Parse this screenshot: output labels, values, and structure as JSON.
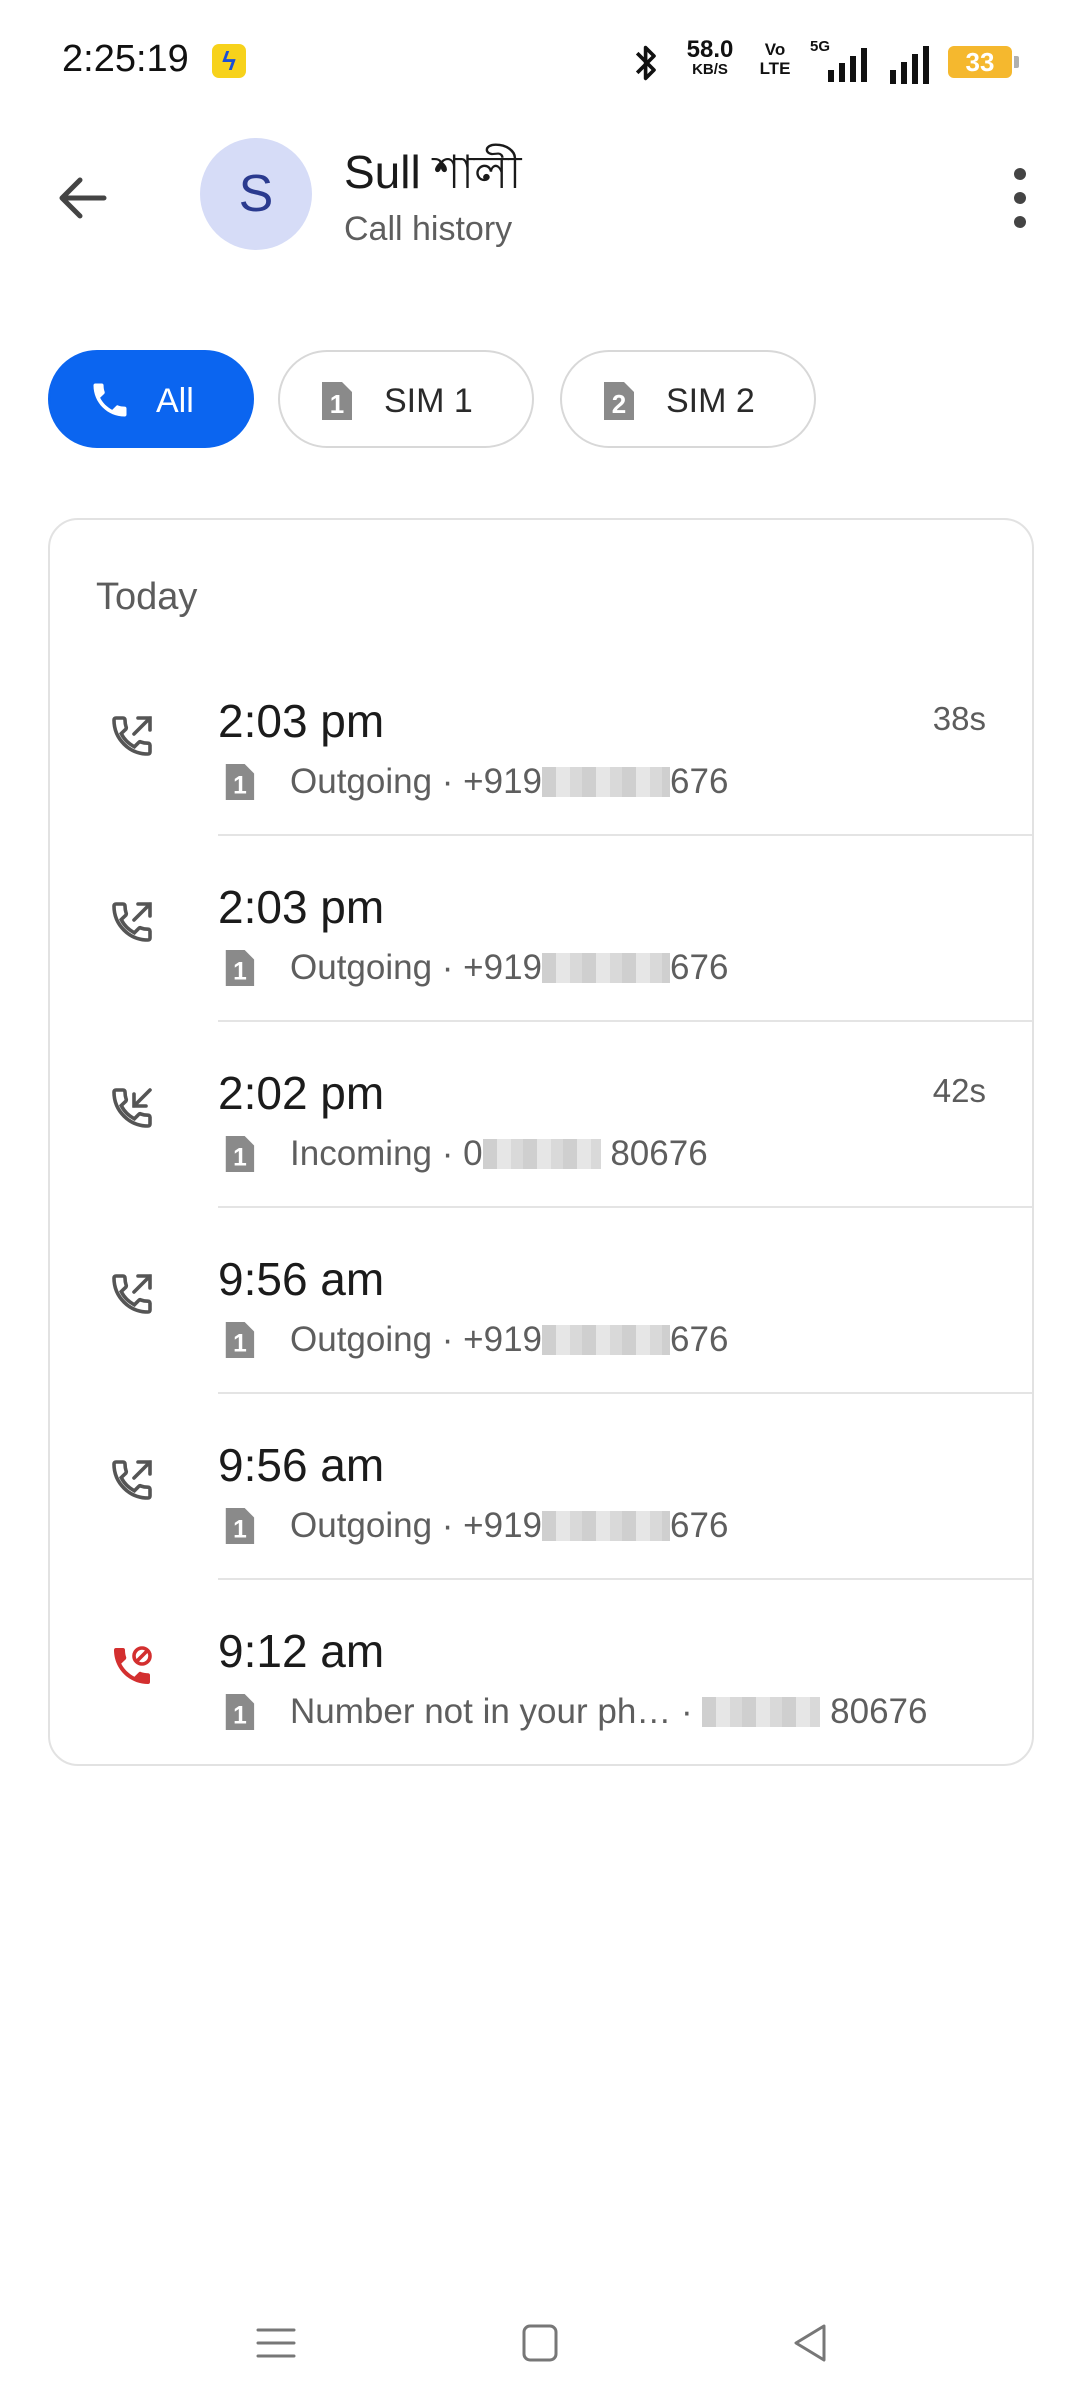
{
  "status_bar": {
    "time": "2:25:19",
    "net_speed_value": "58.0",
    "net_speed_unit": "KB/S",
    "volte_top": "Vo",
    "volte_bottom": "LTE",
    "network_type": "5G",
    "battery": "33",
    "battery_color": "#f5b82e"
  },
  "header": {
    "avatar_letter": "S",
    "name": "Sull শালী",
    "subtitle": "Call history"
  },
  "filters": [
    {
      "label": "All",
      "selected": true,
      "icon": "phone-icon"
    },
    {
      "label": "SIM 1",
      "selected": false,
      "icon": "sim1-icon"
    },
    {
      "label": "SIM 2",
      "selected": false,
      "icon": "sim2-icon"
    }
  ],
  "accent_color": "#0b65f0",
  "missed_color": "#d32f2f",
  "section": {
    "title": "Today"
  },
  "calls": [
    {
      "time": "2:03 pm",
      "duration": "38s",
      "type": "Outgoing",
      "number_prefix": "+919",
      "number_suffix": "676",
      "sim": "1",
      "icon": "outgoing-call-icon"
    },
    {
      "time": "2:03 pm",
      "duration": "",
      "type": "Outgoing",
      "number_prefix": "+919",
      "number_suffix": "676",
      "sim": "1",
      "icon": "outgoing-call-icon"
    },
    {
      "time": "2:02 pm",
      "duration": "42s",
      "type": "Incoming",
      "number_prefix": "0",
      "number_suffix": "80676",
      "sim": "1",
      "icon": "incoming-call-icon"
    },
    {
      "time": "9:56 am",
      "duration": "",
      "type": "Outgoing",
      "number_prefix": "+919",
      "number_suffix": "676",
      "sim": "1",
      "icon": "outgoing-call-icon"
    },
    {
      "time": "9:56 am",
      "duration": "",
      "type": "Outgoing",
      "number_prefix": "+919",
      "number_suffix": "676",
      "sim": "1",
      "icon": "outgoing-call-icon"
    },
    {
      "time": "9:12 am",
      "duration": "",
      "type": "Number not in your ph…",
      "number_prefix": "",
      "number_suffix": "80676",
      "sim": "1",
      "icon": "blocked-call-icon"
    }
  ]
}
